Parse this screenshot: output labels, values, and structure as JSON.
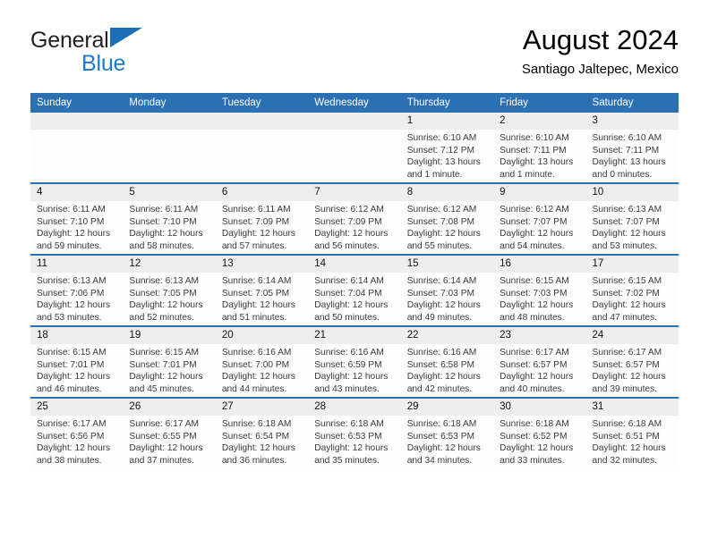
{
  "brand": {
    "name_part1": "General",
    "name_part2": "Blue",
    "logo_icon": "triangle-flag-icon",
    "accent_color": "#1b7ad1"
  },
  "header": {
    "title": "August 2024",
    "subtitle": "Santiago Jaltepec, Mexico"
  },
  "calendar": {
    "header_color": "#2c70b4",
    "daynum_band_color": "#efeeee",
    "weekday_headers": [
      "Sunday",
      "Monday",
      "Tuesday",
      "Wednesday",
      "Thursday",
      "Friday",
      "Saturday"
    ],
    "weeks": [
      [
        {
          "day": "",
          "empty": true,
          "sunrise": "",
          "sunset": "",
          "daylight": ""
        },
        {
          "day": "",
          "empty": true,
          "sunrise": "",
          "sunset": "",
          "daylight": ""
        },
        {
          "day": "",
          "empty": true,
          "sunrise": "",
          "sunset": "",
          "daylight": ""
        },
        {
          "day": "",
          "empty": true,
          "sunrise": "",
          "sunset": "",
          "daylight": ""
        },
        {
          "day": "1",
          "empty": false,
          "sunrise": "Sunrise: 6:10 AM",
          "sunset": "Sunset: 7:12 PM",
          "daylight": "Daylight: 13 hours and 1 minute."
        },
        {
          "day": "2",
          "empty": false,
          "sunrise": "Sunrise: 6:10 AM",
          "sunset": "Sunset: 7:11 PM",
          "daylight": "Daylight: 13 hours and 1 minute."
        },
        {
          "day": "3",
          "empty": false,
          "sunrise": "Sunrise: 6:10 AM",
          "sunset": "Sunset: 7:11 PM",
          "daylight": "Daylight: 13 hours and 0 minutes."
        }
      ],
      [
        {
          "day": "4",
          "empty": false,
          "sunrise": "Sunrise: 6:11 AM",
          "sunset": "Sunset: 7:10 PM",
          "daylight": "Daylight: 12 hours and 59 minutes."
        },
        {
          "day": "5",
          "empty": false,
          "sunrise": "Sunrise: 6:11 AM",
          "sunset": "Sunset: 7:10 PM",
          "daylight": "Daylight: 12 hours and 58 minutes."
        },
        {
          "day": "6",
          "empty": false,
          "sunrise": "Sunrise: 6:11 AM",
          "sunset": "Sunset: 7:09 PM",
          "daylight": "Daylight: 12 hours and 57 minutes."
        },
        {
          "day": "7",
          "empty": false,
          "sunrise": "Sunrise: 6:12 AM",
          "sunset": "Sunset: 7:09 PM",
          "daylight": "Daylight: 12 hours and 56 minutes."
        },
        {
          "day": "8",
          "empty": false,
          "sunrise": "Sunrise: 6:12 AM",
          "sunset": "Sunset: 7:08 PM",
          "daylight": "Daylight: 12 hours and 55 minutes."
        },
        {
          "day": "9",
          "empty": false,
          "sunrise": "Sunrise: 6:12 AM",
          "sunset": "Sunset: 7:07 PM",
          "daylight": "Daylight: 12 hours and 54 minutes."
        },
        {
          "day": "10",
          "empty": false,
          "sunrise": "Sunrise: 6:13 AM",
          "sunset": "Sunset: 7:07 PM",
          "daylight": "Daylight: 12 hours and 53 minutes."
        }
      ],
      [
        {
          "day": "11",
          "empty": false,
          "sunrise": "Sunrise: 6:13 AM",
          "sunset": "Sunset: 7:06 PM",
          "daylight": "Daylight: 12 hours and 53 minutes."
        },
        {
          "day": "12",
          "empty": false,
          "sunrise": "Sunrise: 6:13 AM",
          "sunset": "Sunset: 7:05 PM",
          "daylight": "Daylight: 12 hours and 52 minutes."
        },
        {
          "day": "13",
          "empty": false,
          "sunrise": "Sunrise: 6:14 AM",
          "sunset": "Sunset: 7:05 PM",
          "daylight": "Daylight: 12 hours and 51 minutes."
        },
        {
          "day": "14",
          "empty": false,
          "sunrise": "Sunrise: 6:14 AM",
          "sunset": "Sunset: 7:04 PM",
          "daylight": "Daylight: 12 hours and 50 minutes."
        },
        {
          "day": "15",
          "empty": false,
          "sunrise": "Sunrise: 6:14 AM",
          "sunset": "Sunset: 7:03 PM",
          "daylight": "Daylight: 12 hours and 49 minutes."
        },
        {
          "day": "16",
          "empty": false,
          "sunrise": "Sunrise: 6:15 AM",
          "sunset": "Sunset: 7:03 PM",
          "daylight": "Daylight: 12 hours and 48 minutes."
        },
        {
          "day": "17",
          "empty": false,
          "sunrise": "Sunrise: 6:15 AM",
          "sunset": "Sunset: 7:02 PM",
          "daylight": "Daylight: 12 hours and 47 minutes."
        }
      ],
      [
        {
          "day": "18",
          "empty": false,
          "sunrise": "Sunrise: 6:15 AM",
          "sunset": "Sunset: 7:01 PM",
          "daylight": "Daylight: 12 hours and 46 minutes."
        },
        {
          "day": "19",
          "empty": false,
          "sunrise": "Sunrise: 6:15 AM",
          "sunset": "Sunset: 7:01 PM",
          "daylight": "Daylight: 12 hours and 45 minutes."
        },
        {
          "day": "20",
          "empty": false,
          "sunrise": "Sunrise: 6:16 AM",
          "sunset": "Sunset: 7:00 PM",
          "daylight": "Daylight: 12 hours and 44 minutes."
        },
        {
          "day": "21",
          "empty": false,
          "sunrise": "Sunrise: 6:16 AM",
          "sunset": "Sunset: 6:59 PM",
          "daylight": "Daylight: 12 hours and 43 minutes."
        },
        {
          "day": "22",
          "empty": false,
          "sunrise": "Sunrise: 6:16 AM",
          "sunset": "Sunset: 6:58 PM",
          "daylight": "Daylight: 12 hours and 42 minutes."
        },
        {
          "day": "23",
          "empty": false,
          "sunrise": "Sunrise: 6:17 AM",
          "sunset": "Sunset: 6:57 PM",
          "daylight": "Daylight: 12 hours and 40 minutes."
        },
        {
          "day": "24",
          "empty": false,
          "sunrise": "Sunrise: 6:17 AM",
          "sunset": "Sunset: 6:57 PM",
          "daylight": "Daylight: 12 hours and 39 minutes."
        }
      ],
      [
        {
          "day": "25",
          "empty": false,
          "sunrise": "Sunrise: 6:17 AM",
          "sunset": "Sunset: 6:56 PM",
          "daylight": "Daylight: 12 hours and 38 minutes."
        },
        {
          "day": "26",
          "empty": false,
          "sunrise": "Sunrise: 6:17 AM",
          "sunset": "Sunset: 6:55 PM",
          "daylight": "Daylight: 12 hours and 37 minutes."
        },
        {
          "day": "27",
          "empty": false,
          "sunrise": "Sunrise: 6:18 AM",
          "sunset": "Sunset: 6:54 PM",
          "daylight": "Daylight: 12 hours and 36 minutes."
        },
        {
          "day": "28",
          "empty": false,
          "sunrise": "Sunrise: 6:18 AM",
          "sunset": "Sunset: 6:53 PM",
          "daylight": "Daylight: 12 hours and 35 minutes."
        },
        {
          "day": "29",
          "empty": false,
          "sunrise": "Sunrise: 6:18 AM",
          "sunset": "Sunset: 6:53 PM",
          "daylight": "Daylight: 12 hours and 34 minutes."
        },
        {
          "day": "30",
          "empty": false,
          "sunrise": "Sunrise: 6:18 AM",
          "sunset": "Sunset: 6:52 PM",
          "daylight": "Daylight: 12 hours and 33 minutes."
        },
        {
          "day": "31",
          "empty": false,
          "sunrise": "Sunrise: 6:18 AM",
          "sunset": "Sunset: 6:51 PM",
          "daylight": "Daylight: 12 hours and 32 minutes."
        }
      ]
    ]
  }
}
